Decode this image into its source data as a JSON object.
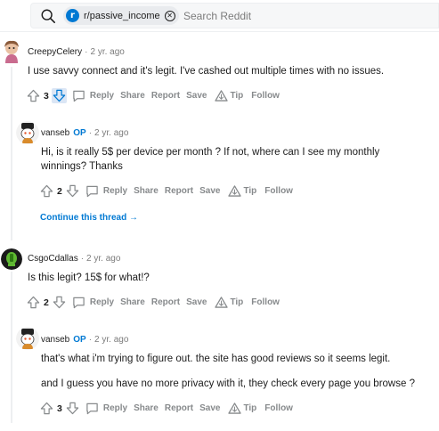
{
  "search": {
    "subreddit": "r/passive_income",
    "placeholder": "Search Reddit",
    "chip_icon": "r"
  },
  "colors": {
    "accent": "#0079d3",
    "muted": "#878a8c",
    "downvote_active_bg": "#dbe6f5"
  },
  "comments": [
    {
      "author": "CreepyCelery",
      "time": "2 yr. ago",
      "text": "I use savvy connect and it's legit. I've cashed out multiple times with no issues.",
      "score": "3",
      "avatar_icon": "snoo-avatar-icon",
      "downvote_active": true
    },
    {
      "author": "vanseb",
      "op": "OP",
      "time": "2 yr. ago",
      "text": "Hi, is it really 5$ per device per month ? If not, where can I see my monthly winnings? Thanks",
      "score": "2",
      "avatar_icon": "snoo-avatar-icon"
    },
    {
      "author": "CsgoCdallas",
      "time": "2 yr. ago",
      "text": "Is this legit? 15$ for what!?",
      "score": "2",
      "avatar_icon": "snoo-avatar-icon"
    },
    {
      "author": "vanseb",
      "op": "OP",
      "time": "2 yr. ago",
      "text": "that's what i'm trying to figure out. the site has good reviews so it seems legit.",
      "text2": "and I guess you have no more privacy with it, they check every page you browse ?",
      "score": "3",
      "avatar_icon": "snoo-avatar-icon"
    }
  ],
  "actions": {
    "reply": "Reply",
    "share": "Share",
    "report": "Report",
    "save": "Save",
    "tip": "Tip",
    "follow": "Follow"
  },
  "continue_thread": "Continue this thread →",
  "separator": "·"
}
